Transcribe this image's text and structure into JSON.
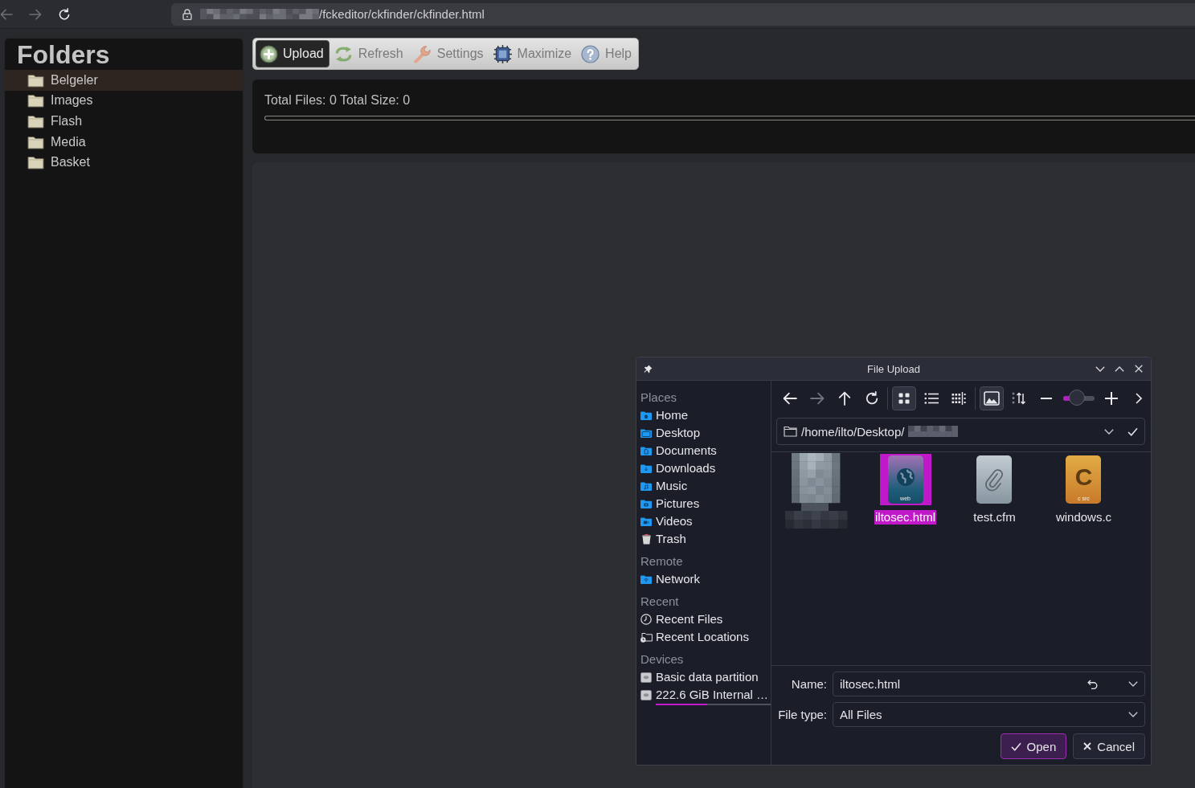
{
  "browser": {
    "nav": [
      {
        "kind": "back",
        "disabled": true
      },
      {
        "kind": "forward",
        "disabled": true
      },
      {
        "kind": "reload",
        "disabled": false
      }
    ],
    "url": "/fckeditor/ckfinder/ckfinder.html"
  },
  "folders": {
    "title": "Folders",
    "items": [
      {
        "label": "Belgeler",
        "selected": true
      },
      {
        "label": "Images",
        "selected": false
      },
      {
        "label": "Flash",
        "selected": false
      },
      {
        "label": "Media",
        "selected": false
      },
      {
        "label": "Basket",
        "selected": false
      }
    ]
  },
  "toolbar": {
    "buttons": [
      {
        "kind": "upload",
        "label": "Upload",
        "selected": true
      },
      {
        "kind": "refresh",
        "label": "Refresh",
        "selected": false
      },
      {
        "kind": "settings",
        "label": "Settings",
        "selected": false
      },
      {
        "kind": "maximize",
        "label": "Maximize",
        "selected": false
      },
      {
        "kind": "help",
        "label": "Help",
        "selected": false
      }
    ]
  },
  "upload_status": {
    "summary": "Total Files: 0 Total Size: 0",
    "progress": {
      "level": 0
    }
  },
  "dialog": {
    "title": "File Upload",
    "places": [
      {
        "heading": "Places",
        "items": [
          {
            "kind": "home",
            "label": "Home",
            "selected": false
          },
          {
            "kind": "desktop",
            "label": "Desktop",
            "selected": false
          },
          {
            "kind": "documents",
            "label": "Documents",
            "selected": false
          },
          {
            "kind": "downloads",
            "label": "Downloads",
            "selected": false
          },
          {
            "kind": "music",
            "label": "Music",
            "selected": false
          },
          {
            "kind": "pictures",
            "label": "Pictures",
            "selected": false
          },
          {
            "kind": "videos",
            "label": "Videos",
            "selected": false
          },
          {
            "kind": "trash",
            "label": "Trash",
            "selected": false
          }
        ]
      },
      {
        "heading": "Remote",
        "items": [
          {
            "kind": "network",
            "label": "Network",
            "selected": false
          }
        ]
      },
      {
        "heading": "Recent",
        "items": [
          {
            "kind": "recent_files",
            "label": "Recent Files",
            "selected": false
          },
          {
            "kind": "recent_locations",
            "label": "Recent Locations",
            "selected": false
          }
        ]
      },
      {
        "heading": "Devices",
        "items": [
          {
            "kind": "drive",
            "label": "Basic data partition",
            "selected": false
          },
          {
            "kind": "drive",
            "label": "222.6 GiB Internal …",
            "selected": false,
            "level": 0.45
          }
        ]
      }
    ],
    "nav": [
      {
        "kind": "back",
        "disabled": false
      },
      {
        "kind": "forward",
        "disabled": true
      },
      {
        "kind": "up",
        "disabled": false
      },
      {
        "kind": "reload",
        "disabled": false
      }
    ],
    "view_modes": [
      {
        "kind": "icons",
        "selected": true
      },
      {
        "kind": "details",
        "selected": false
      },
      {
        "kind": "compact",
        "selected": false
      }
    ],
    "preview": {
      "on": true
    },
    "zoom": {
      "level": 0.45
    },
    "path": "/home/ilto/Desktop/",
    "files": [
      {
        "kind": "pixelated",
        "selected": false
      },
      {
        "kind": "web",
        "name": "iltosec.html",
        "badge": "web",
        "selected": true
      },
      {
        "kind": "attachment",
        "name": "test.cfm",
        "selected": false
      },
      {
        "kind": "c_source",
        "name": "windows.c",
        "letter": "C",
        "badge": "c src",
        "selected": false
      }
    ],
    "name_field": {
      "label": "Name:",
      "value": "iltosec.html"
    },
    "type_field": {
      "label": "File type:",
      "value": "All Files"
    },
    "buttons": [
      {
        "kind": "open",
        "label": "Open",
        "default": true
      },
      {
        "kind": "cancel",
        "label": "Cancel",
        "default": false
      }
    ]
  }
}
